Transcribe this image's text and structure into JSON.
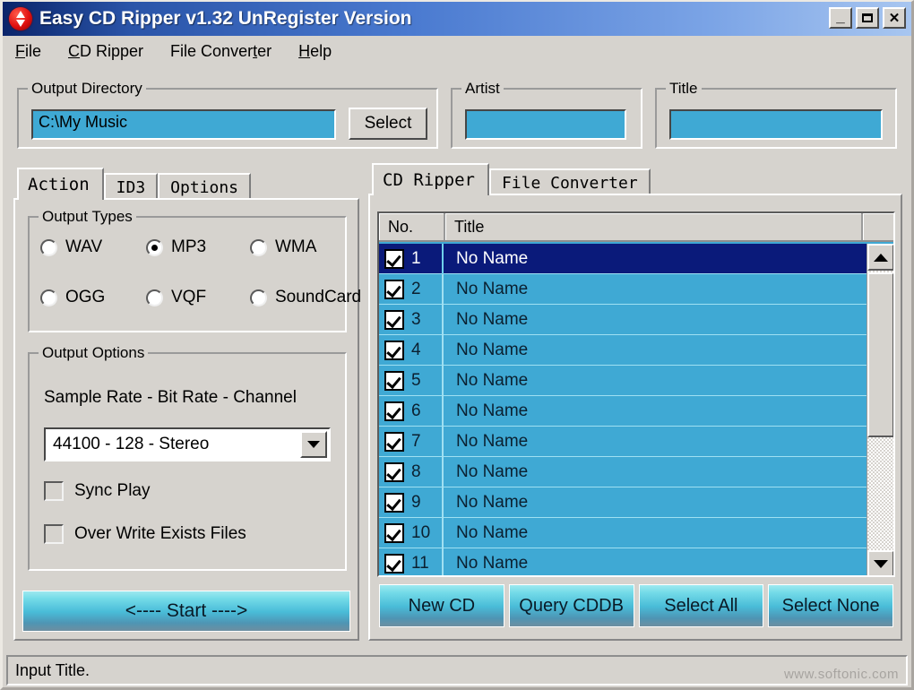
{
  "window": {
    "title": "Easy CD Ripper v1.32 UnRegister Version",
    "icon": "cd-ripper-icon",
    "buttons": {
      "minimize": "_",
      "maximize": "□",
      "close": "✕"
    }
  },
  "menubar": {
    "items": [
      {
        "label": "File",
        "accel": "F"
      },
      {
        "label": "CD Ripper",
        "accel": "C"
      },
      {
        "label": "File Converter",
        "accel": "t"
      },
      {
        "label": "Help",
        "accel": "H"
      }
    ]
  },
  "top_fields": {
    "output_directory": {
      "group_label": "Output Directory",
      "value": "C:\\My Music",
      "placeholder": "",
      "select_button": "Select"
    },
    "artist": {
      "group_label": "Artist",
      "value": "",
      "placeholder": ""
    },
    "title": {
      "group_label": "Title",
      "value": "",
      "placeholder": ""
    }
  },
  "left_panel": {
    "tabs": [
      {
        "label": "Action",
        "active": true
      },
      {
        "label": "ID3",
        "active": false
      },
      {
        "label": "Options",
        "active": false
      }
    ],
    "output_types": {
      "group_label": "Output Types",
      "selected": "MP3",
      "options": [
        {
          "label": "WAV",
          "selected": false
        },
        {
          "label": "MP3",
          "selected": true
        },
        {
          "label": "WMA",
          "selected": false
        },
        {
          "label": "OGG",
          "selected": false
        },
        {
          "label": "VQF",
          "selected": false
        },
        {
          "label": "SoundCard",
          "selected": false
        }
      ]
    },
    "output_options": {
      "group_label": "Output Options",
      "caption": "Sample Rate - Bit Rate - Channel",
      "combo_value": "44100 - 128 - Stereo",
      "checkboxes": [
        {
          "label": "Sync Play",
          "checked": false
        },
        {
          "label": "Over Write Exists Files",
          "checked": false
        }
      ]
    },
    "start_button": "<---- Start ---->"
  },
  "right_panel": {
    "tabs": [
      {
        "label": "CD Ripper",
        "active": true
      },
      {
        "label": "File Converter",
        "active": false
      }
    ],
    "list": {
      "columns": [
        "No.",
        "Title"
      ],
      "rows": [
        {
          "no": "1",
          "title": "No Name",
          "checked": true,
          "selected": true
        },
        {
          "no": "2",
          "title": "No Name",
          "checked": true,
          "selected": false
        },
        {
          "no": "3",
          "title": "No Name",
          "checked": true,
          "selected": false
        },
        {
          "no": "4",
          "title": "No Name",
          "checked": true,
          "selected": false
        },
        {
          "no": "5",
          "title": "No Name",
          "checked": true,
          "selected": false
        },
        {
          "no": "6",
          "title": "No Name",
          "checked": true,
          "selected": false
        },
        {
          "no": "7",
          "title": "No Name",
          "checked": true,
          "selected": false
        },
        {
          "no": "8",
          "title": "No Name",
          "checked": true,
          "selected": false
        },
        {
          "no": "9",
          "title": "No Name",
          "checked": true,
          "selected": false
        },
        {
          "no": "10",
          "title": "No Name",
          "checked": true,
          "selected": false
        },
        {
          "no": "11",
          "title": "No Name",
          "checked": true,
          "selected": false
        }
      ]
    },
    "actions": [
      "New CD",
      "Query CDDB",
      "Select All",
      "Select None"
    ]
  },
  "statusbar": {
    "text": "Input Title.",
    "watermark": "www.softonic.com"
  },
  "colors": {
    "titlebar_start": "#0a246a",
    "titlebar_end": "#a8c6f0",
    "field_cyan": "#3fa9d4",
    "row_selected": "#0a1a7a",
    "face": "#d6d3ce",
    "aqua_top": "#9ee9ef",
    "aqua_bottom": "#6e8fa0"
  }
}
